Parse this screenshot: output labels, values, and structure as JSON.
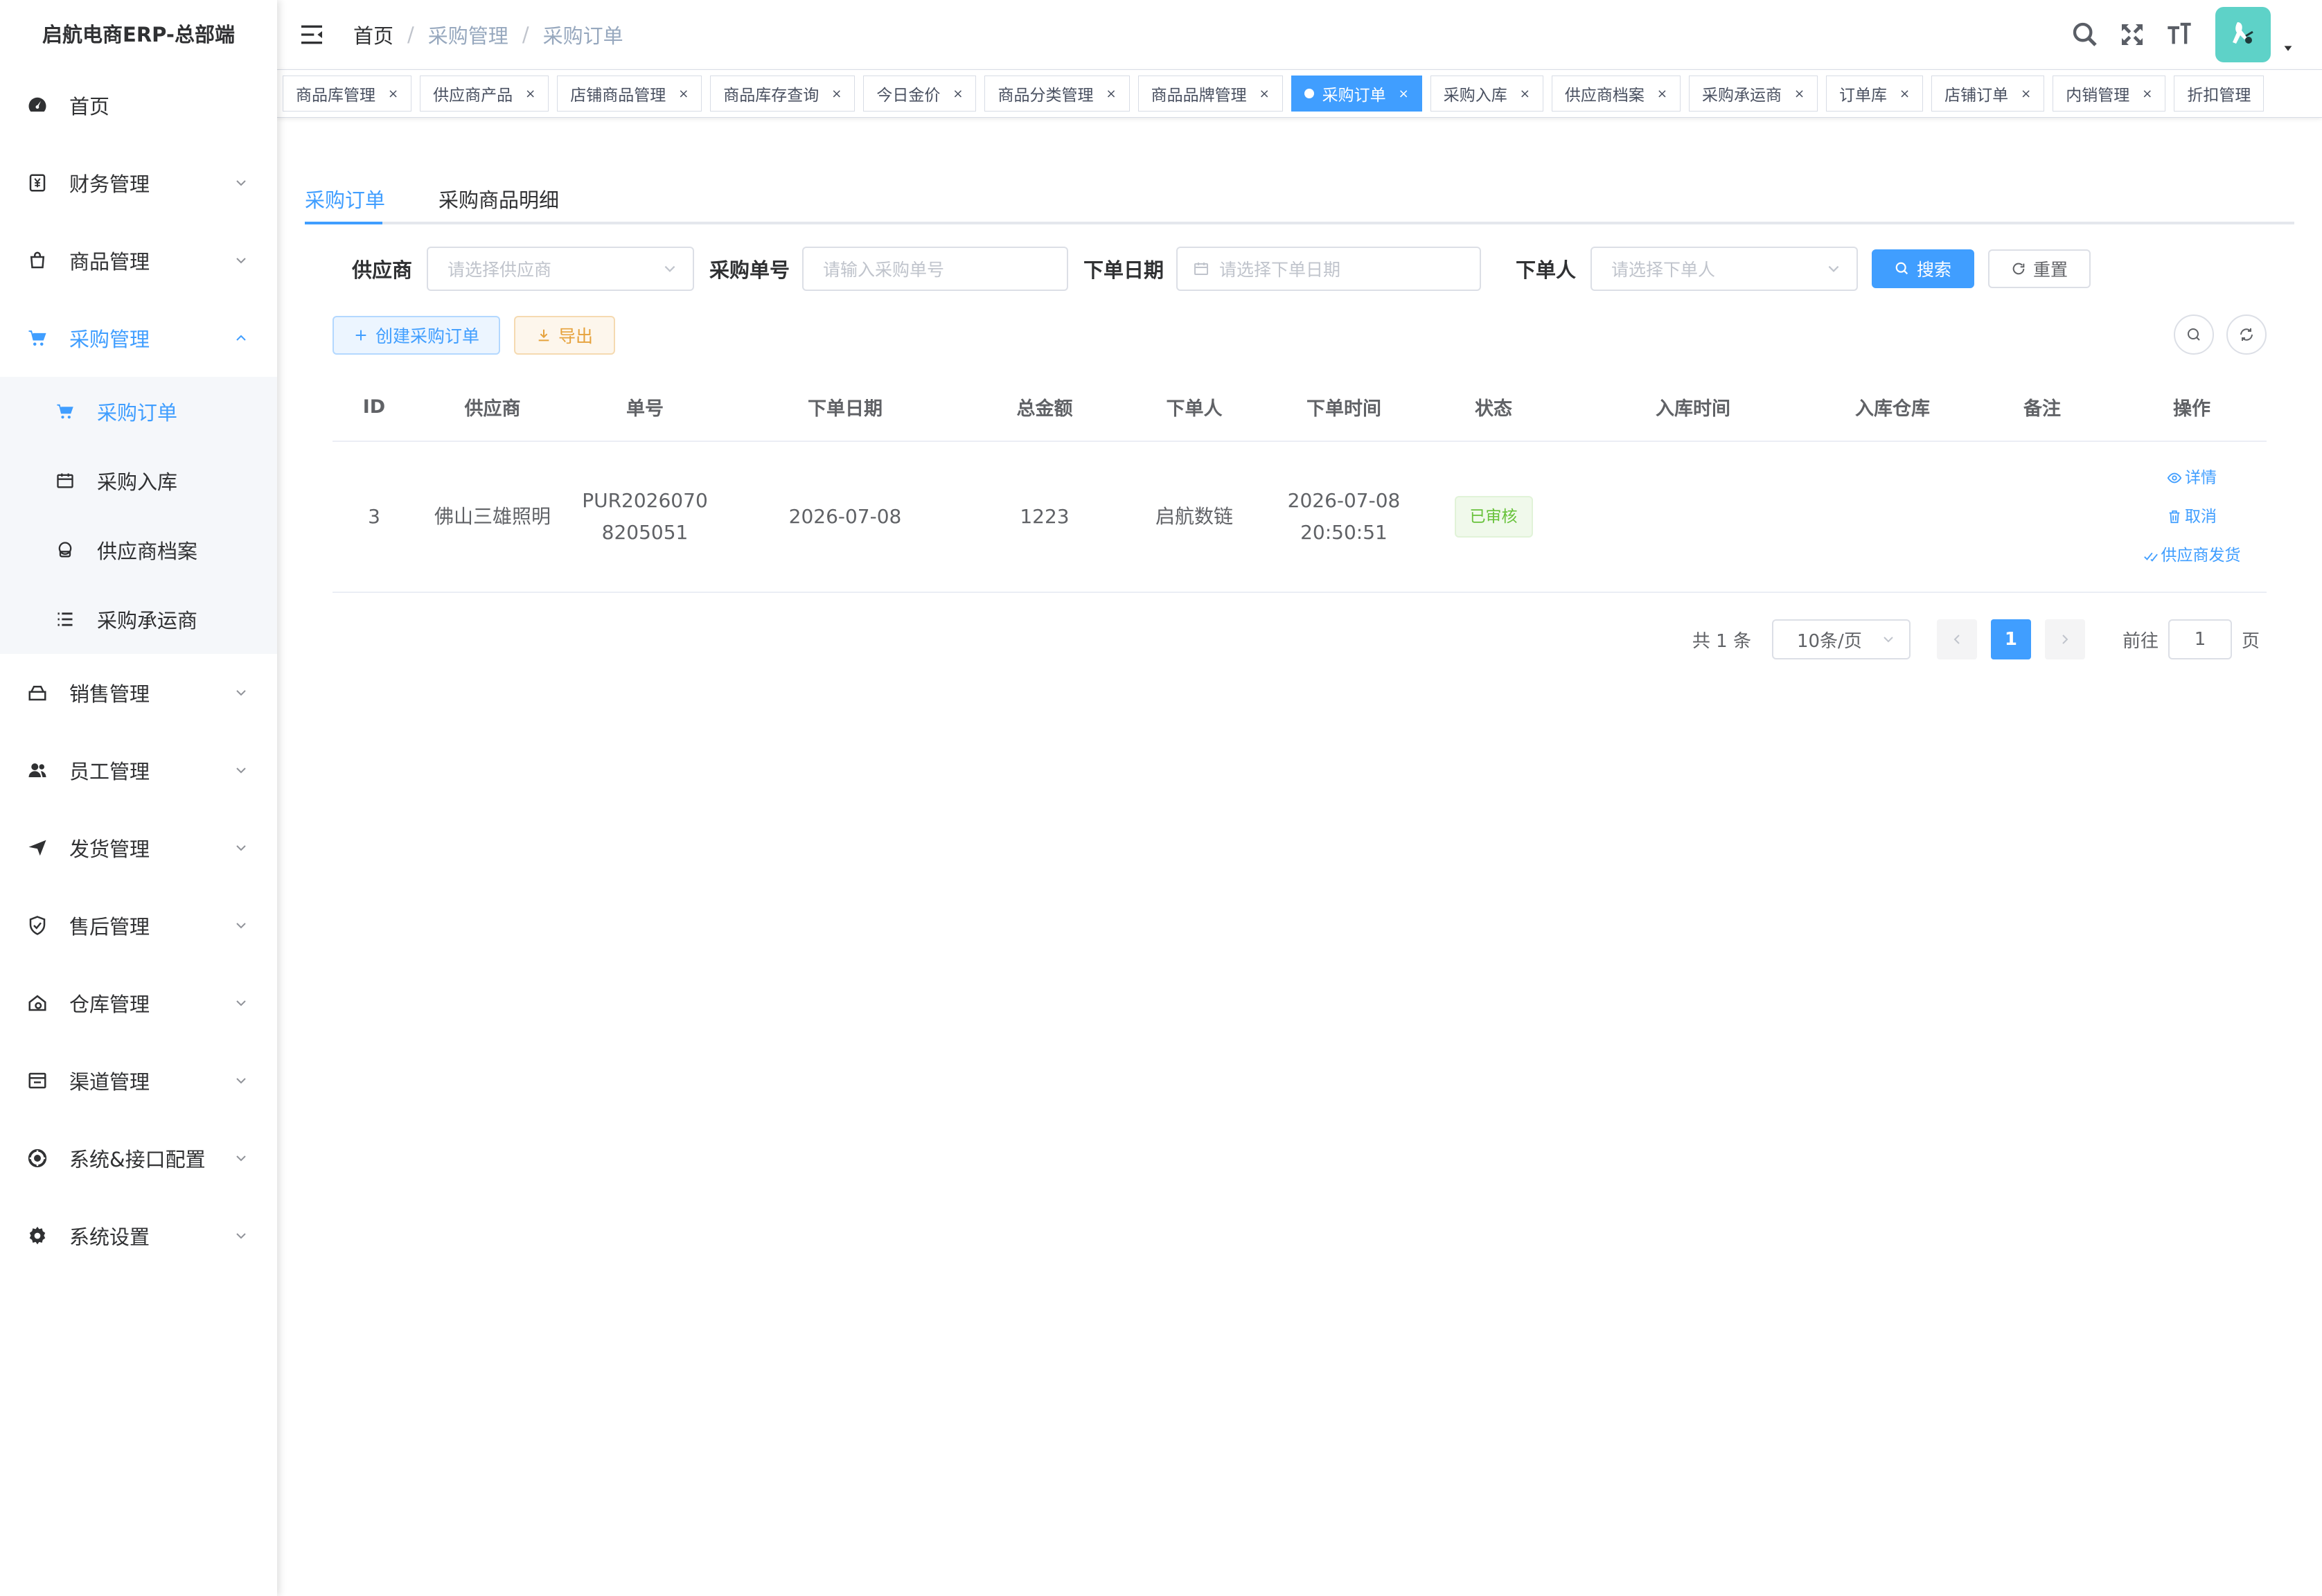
{
  "app": {
    "title": "启航电商ERP-总部端"
  },
  "sidebar": {
    "items": [
      {
        "label": "首页",
        "icon": "dashboard-icon"
      },
      {
        "label": "财务管理",
        "icon": "finance-icon"
      },
      {
        "label": "商品管理",
        "icon": "goods-icon"
      },
      {
        "label": "采购管理",
        "icon": "cart-icon",
        "active": true
      },
      {
        "label": "销售管理",
        "icon": "sales-icon"
      },
      {
        "label": "员工管理",
        "icon": "people-icon"
      },
      {
        "label": "发货管理",
        "icon": "send-icon"
      },
      {
        "label": "售后管理",
        "icon": "shield-icon"
      },
      {
        "label": "仓库管理",
        "icon": "warehouse-icon"
      },
      {
        "label": "渠道管理",
        "icon": "channel-icon"
      },
      {
        "label": "系统&接口配置",
        "icon": "config-icon"
      },
      {
        "label": "系统设置",
        "icon": "gear-icon"
      }
    ],
    "purchase_sub": [
      {
        "label": "采购订单",
        "icon": "cart-icon",
        "active": true
      },
      {
        "label": "采购入库",
        "icon": "calendar-icon"
      },
      {
        "label": "供应商档案",
        "icon": "supplier-icon"
      },
      {
        "label": "采购承运商",
        "icon": "list-icon"
      }
    ]
  },
  "header": {
    "breadcrumb": [
      "首页",
      "采购管理",
      "采购订单"
    ]
  },
  "tags": [
    {
      "label": "商品库管理"
    },
    {
      "label": "供应商产品"
    },
    {
      "label": "店铺商品管理"
    },
    {
      "label": "商品库存查询"
    },
    {
      "label": "今日金价"
    },
    {
      "label": "商品分类管理"
    },
    {
      "label": "商品品牌管理"
    },
    {
      "label": "采购订单",
      "active": true
    },
    {
      "label": "采购入库"
    },
    {
      "label": "供应商档案"
    },
    {
      "label": "采购承运商"
    },
    {
      "label": "订单库"
    },
    {
      "label": "店铺订单"
    },
    {
      "label": "内销管理"
    },
    {
      "label": "折扣管理"
    }
  ],
  "tabs": {
    "orders": "采购订单",
    "details": "采购商品明细"
  },
  "filter": {
    "supplier_label": "供应商",
    "supplier_placeholder": "请选择供应商",
    "order_no_label": "采购单号",
    "order_no_placeholder": "请输入采购单号",
    "order_date_label": "下单日期",
    "order_date_placeholder": "请选择下单日期",
    "orderer_label": "下单人",
    "orderer_placeholder": "请选择下单人",
    "search": "搜索",
    "reset": "重置"
  },
  "actions": {
    "create": "创建采购订单",
    "export": "导出"
  },
  "table": {
    "columns": [
      "ID",
      "供应商",
      "单号",
      "下单日期",
      "总金额",
      "下单人",
      "下单时间",
      "状态",
      "入库时间",
      "入库仓库",
      "备注",
      "操作"
    ],
    "rows": [
      {
        "id": "3",
        "supplier": "佛山三雄照明",
        "order_no_line1": "PUR2026070",
        "order_no_line2": "8205051",
        "order_date": "2026-07-08",
        "amount": "1223",
        "orderer": "启航数链",
        "order_time_line1": "2026-07-08",
        "order_time_line2": "20:50:51",
        "status": "已审核",
        "inbound_time": "",
        "warehouse": "",
        "remark": "",
        "ops": {
          "detail": "详情",
          "cancel": "取消",
          "ship": "供应商发货"
        }
      }
    ]
  },
  "pagination": {
    "total": "共 1 条",
    "page_size": "10条/页",
    "current": "1",
    "goto_label": "前往",
    "goto_value": "1",
    "page_suffix": "页"
  },
  "colors": {
    "primary": "#409eff",
    "success": "#67c23a",
    "warning": "#e6a23c",
    "avatar_bg": "#5ed2c8"
  }
}
